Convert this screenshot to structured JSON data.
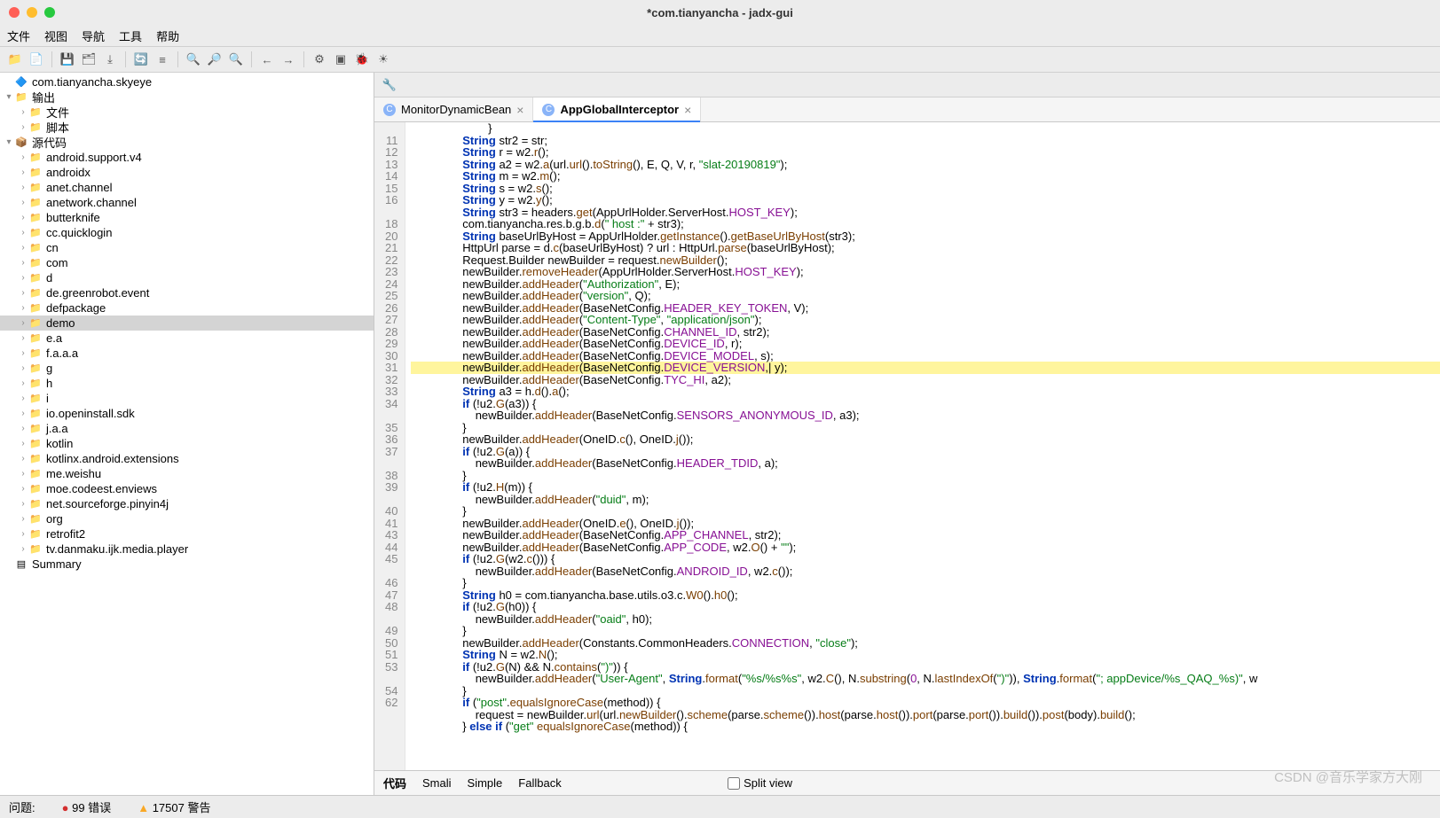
{
  "window": {
    "title": "*com.tianyancha - jadx-gui"
  },
  "menubar": [
    "文件",
    "视图",
    "导航",
    "工具",
    "帮助"
  ],
  "tree": {
    "root": "com.tianyancha.skyeye",
    "output": {
      "label": "输出",
      "children": [
        "文件",
        "脚本"
      ]
    },
    "source": {
      "label": "源代码",
      "children": [
        "android.support.v4",
        "androidx",
        "anet.channel",
        "anetwork.channel",
        "butterknife",
        "cc.quicklogin",
        "cn",
        "com",
        "d",
        "de.greenrobot.event",
        "defpackage",
        "demo",
        "e.a",
        "f.a.a.a",
        "g",
        "h",
        "i",
        "io.openinstall.sdk",
        "j.a.a",
        "kotlin",
        "kotlinx.android.extensions",
        "me.weishu",
        "moe.codeest.enviews",
        "net.sourceforge.pinyin4j",
        "org",
        "retrofit2",
        "tv.danmaku.ijk.media.player"
      ]
    },
    "summary": "Summary"
  },
  "tabs": [
    {
      "label": "MonitorDynamicBean",
      "active": false
    },
    {
      "label": "AppGlobalInterceptor",
      "active": true
    }
  ],
  "line_numbers": [
    "",
    "11",
    "12",
    "13",
    "14",
    "15",
    "16",
    "",
    "18",
    "20",
    "21",
    "22",
    "23",
    "24",
    "25",
    "26",
    "27",
    "28",
    "29",
    "30",
    "31",
    "32",
    "33",
    "34",
    "",
    "35",
    "36",
    "37",
    "",
    "38",
    "39",
    "",
    "40",
    "41",
    "43",
    "44",
    "45",
    "",
    "46",
    "47",
    "48",
    "",
    "49",
    "50",
    "51",
    "53",
    "",
    "54",
    "62",
    ""
  ],
  "code_lines": [
    {
      "indent": 24,
      "html": "<span class='paren'>}</span>"
    },
    {
      "indent": 16,
      "html": "<span class='kw'>String</span> str2 = str;"
    },
    {
      "indent": 16,
      "html": "<span class='kw'>String</span> r = w2.<span class='method'>r</span>();"
    },
    {
      "indent": 16,
      "html": "<span class='kw'>String</span> a2 = w2.<span class='method'>a</span>(url.<span class='method'>url</span>().<span class='method'>toString</span>(), E, Q, V, r, <span class='str'>\"slat-20190819\"</span>);"
    },
    {
      "indent": 16,
      "html": "<span class='kw'>String</span> m = w2.<span class='method'>m</span>();"
    },
    {
      "indent": 16,
      "html": "<span class='kw'>String</span> s = w2.<span class='method'>s</span>();"
    },
    {
      "indent": 16,
      "html": "<span class='kw'>String</span> y = w2.<span class='method'>y</span>();"
    },
    {
      "indent": 16,
      "html": "<span class='kw'>String</span> str3 = headers.<span class='method'>get</span>(AppUrlHolder.ServerHost.<span class='const'>HOST_KEY</span>);"
    },
    {
      "indent": 16,
      "html": "com.tianyancha.res.b.g.b.<span class='method'>d</span>(<span class='str'>\" host :\"</span> + str3);"
    },
    {
      "indent": 16,
      "html": "<span class='kw'>String</span> baseUrlByHost = AppUrlHolder.<span class='method'>getInstance</span>().<span class='method'>getBaseUrlByHost</span>(str3);"
    },
    {
      "indent": 16,
      "html": "HttpUrl parse = d.<span class='method'>c</span>(baseUrlByHost) ? url : HttpUrl.<span class='method'>parse</span>(baseUrlByHost);"
    },
    {
      "indent": 16,
      "html": "Request.Builder newBuilder = request.<span class='method'>newBuilder</span>();"
    },
    {
      "indent": 16,
      "html": "newBuilder.<span class='method'>removeHeader</span>(AppUrlHolder.ServerHost.<span class='const'>HOST_KEY</span>);"
    },
    {
      "indent": 16,
      "html": "newBuilder.<span class='method'>addHeader</span>(<span class='str'>\"Authorization\"</span>, E);"
    },
    {
      "indent": 16,
      "html": "newBuilder.<span class='method'>addHeader</span>(<span class='str'>\"version\"</span>, Q);"
    },
    {
      "indent": 16,
      "html": "newBuilder.<span class='method'>addHeader</span>(BaseNetConfig.<span class='const'>HEADER_KEY_TOKEN</span>, V);"
    },
    {
      "indent": 16,
      "html": "newBuilder.<span class='method'>addHeader</span>(<span class='str'>\"Content-Type\"</span>, <span class='str'>\"application/json\"</span>);"
    },
    {
      "indent": 16,
      "html": "newBuilder.<span class='method'>addHeader</span>(BaseNetConfig.<span class='const'>CHANNEL_ID</span>, str2);"
    },
    {
      "indent": 16,
      "html": "newBuilder.<span class='method'>addHeader</span>(BaseNetConfig.<span class='const'>DEVICE_ID</span>, r);"
    },
    {
      "indent": 16,
      "html": "newBuilder.<span class='method'>addHeader</span>(BaseNetConfig.<span class='const'>DEVICE_MODEL</span>, s);"
    },
    {
      "indent": 16,
      "hl": true,
      "html": "newBuilder.<span class='method'>addHeader</span>(BaseNetConfig.<span class='const'>DEVICE_VERSION</span>,| y);"
    },
    {
      "indent": 16,
      "html": "newBuilder.<span class='method'>addHeader</span>(BaseNetConfig.<span class='const'>TYC_HI</span>, a2);"
    },
    {
      "indent": 16,
      "html": "<span class='kw'>String</span> a3 = h.<span class='method'>d</span>().<span class='method'>a</span>();"
    },
    {
      "indent": 16,
      "html": "<span class='kw'>if</span> (!u2.<span class='method'>G</span>(a3)) {"
    },
    {
      "indent": 20,
      "html": "newBuilder.<span class='method'>addHeader</span>(BaseNetConfig.<span class='const'>SENSORS_ANONYMOUS_ID</span>, a3);"
    },
    {
      "indent": 16,
      "html": "}"
    },
    {
      "indent": 16,
      "html": "newBuilder.<span class='method'>addHeader</span>(OneID.<span class='method'>c</span>(), OneID.<span class='method'>j</span>());"
    },
    {
      "indent": 16,
      "html": "<span class='kw'>if</span> (!u2.<span class='method'>G</span>(a)) {"
    },
    {
      "indent": 20,
      "html": "newBuilder.<span class='method'>addHeader</span>(BaseNetConfig.<span class='const'>HEADER_TDID</span>, a);"
    },
    {
      "indent": 16,
      "html": "}"
    },
    {
      "indent": 16,
      "html": "<span class='kw'>if</span> (!u2.<span class='method'>H</span>(m)) {"
    },
    {
      "indent": 20,
      "html": "newBuilder.<span class='method'>addHeader</span>(<span class='str'>\"duid\"</span>, m);"
    },
    {
      "indent": 16,
      "html": "}"
    },
    {
      "indent": 16,
      "html": "newBuilder.<span class='method'>addHeader</span>(OneID.<span class='method'>e</span>(), OneID.<span class='method'>j</span>());"
    },
    {
      "indent": 16,
      "html": "newBuilder.<span class='method'>addHeader</span>(BaseNetConfig.<span class='const'>APP_CHANNEL</span>, str2);"
    },
    {
      "indent": 16,
      "html": "newBuilder.<span class='method'>addHeader</span>(BaseNetConfig.<span class='const'>APP_CODE</span>, w2.<span class='method'>O</span>() + <span class='str'>\"\"</span>);"
    },
    {
      "indent": 16,
      "html": "<span class='kw'>if</span> (!u2.<span class='method'>G</span>(w2.<span class='method'>c</span>())) {"
    },
    {
      "indent": 20,
      "html": "newBuilder.<span class='method'>addHeader</span>(BaseNetConfig.<span class='const'>ANDROID_ID</span>, w2.<span class='method'>c</span>());"
    },
    {
      "indent": 16,
      "html": "}"
    },
    {
      "indent": 16,
      "html": "<span class='kw'>String</span> h0 = com.tianyancha.base.utils.o3.c.<span class='method'>W0</span>().<span class='method'>h0</span>();"
    },
    {
      "indent": 16,
      "html": "<span class='kw'>if</span> (!u2.<span class='method'>G</span>(h0)) {"
    },
    {
      "indent": 20,
      "html": "newBuilder.<span class='method'>addHeader</span>(<span class='str'>\"oaid\"</span>, h0);"
    },
    {
      "indent": 16,
      "html": "}"
    },
    {
      "indent": 16,
      "html": "newBuilder.<span class='method'>addHeader</span>(Constants.CommonHeaders.<span class='const'>CONNECTION</span>, <span class='str'>\"close\"</span>);"
    },
    {
      "indent": 16,
      "html": "<span class='kw'>String</span> N = w2.<span class='method'>N</span>();"
    },
    {
      "indent": 16,
      "html": "<span class='kw'>if</span> (!u2.<span class='method'>G</span>(N) && N.<span class='method'>contains</span>(<span class='str'>\")\"</span>)) {"
    },
    {
      "indent": 20,
      "html": "newBuilder.<span class='method'>addHeader</span>(<span class='str'>\"User-Agent\"</span>, <span class='kw'>String</span>.<span class='method'>format</span>(<span class='str'>\"%s/%s%s\"</span>, w2.<span class='method'>C</span>(), N.<span class='method'>substring</span>(<span class='num'>0</span>, N.<span class='method'>lastIndexOf</span>(<span class='str'>\")\"</span>)), <span class='kw'>String</span>.<span class='method'>format</span>(<span class='str'>\"; appDevice/%s_QAQ_%s)\"</span>, w"
    },
    {
      "indent": 16,
      "html": "}"
    },
    {
      "indent": 16,
      "html": "<span class='kw'>if</span> (<span class='str'>\"post\"</span>.<span class='method'>equalsIgnoreCase</span>(method)) {"
    },
    {
      "indent": 20,
      "html": "request = newBuilder.<span class='method'>url</span>(url.<span class='method'>newBuilder</span>().<span class='method'>scheme</span>(parse.<span class='method'>scheme</span>()).<span class='method'>host</span>(parse.<span class='method'>host</span>()).<span class='method'>port</span>(parse.<span class='method'>port</span>()).<span class='method'>build</span>()).<span class='method'>post</span>(body).<span class='method'>build</span>();"
    },
    {
      "indent": 16,
      "html": "<span class='paren'>}</span> <span class='kw'>else if</span> (<span class='str'>\"get\"</span> <span class='method'>equalsIgnoreCase</span>(method)) {"
    }
  ],
  "bottom_tabs": [
    "代码",
    "Smali",
    "Simple",
    "Fallback"
  ],
  "split_view": "Split view",
  "status": {
    "label": "问题:",
    "errors": "99 错误",
    "warnings": "17507 警告"
  },
  "watermark": "CSDN @音乐学家方大刚"
}
